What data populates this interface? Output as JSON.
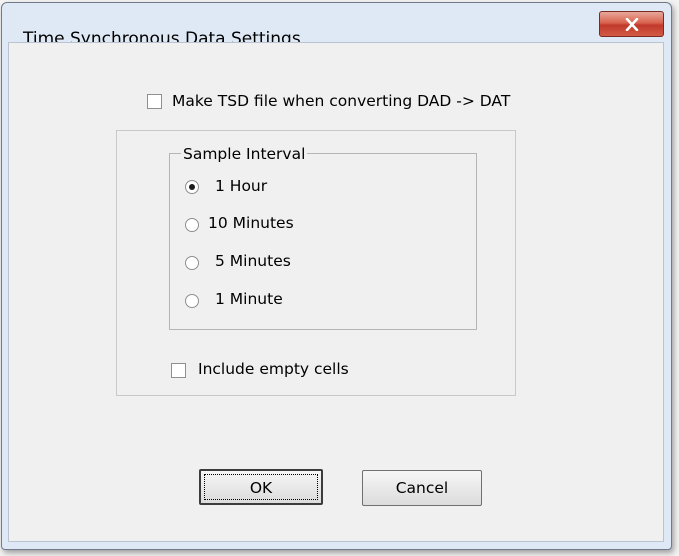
{
  "window": {
    "title": "Time Synchronous Data Settings",
    "close_label": "×"
  },
  "options": {
    "make_tsd_label": "Make TSD file when converting DAD -> DAT",
    "make_tsd_checked": false,
    "include_empty_label": "Include empty cells",
    "include_empty_checked": false
  },
  "sample_interval": {
    "legend": "Sample Interval",
    "options": [
      {
        "label": "1 Hour",
        "selected": true
      },
      {
        "label": "10 Minutes",
        "selected": false
      },
      {
        "label": "5 Minutes",
        "selected": false
      },
      {
        "label": "1 Minute",
        "selected": false
      }
    ]
  },
  "buttons": {
    "ok": "OK",
    "cancel": "Cancel"
  }
}
